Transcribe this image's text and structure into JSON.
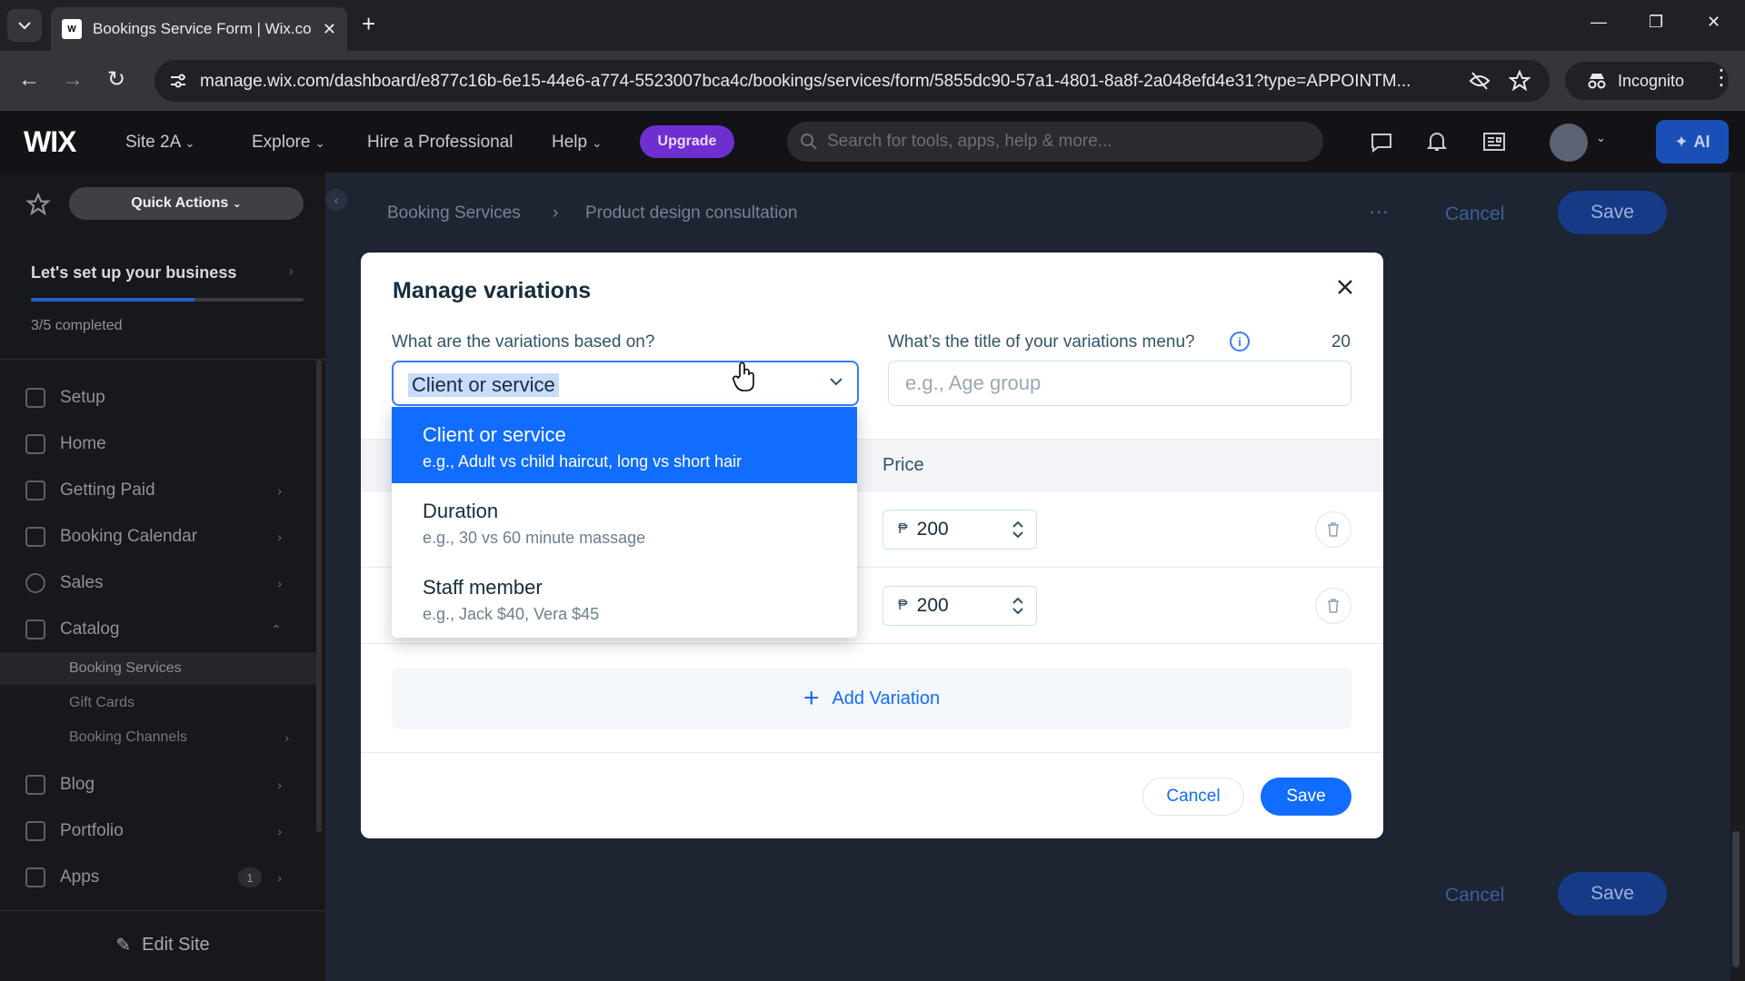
{
  "browser": {
    "tab_title": "Bookings Service Form | Wix.com",
    "url": "manage.wix.com/dashboard/e877c16b-6e15-44e6-a774-5523007bca4c/bookings/services/form/5855dc90-57a1-4801-8a8f-2a048efd4e31?type=APPOINTM...",
    "incognito_label": "Incognito"
  },
  "wix_bar": {
    "logo": "WIX",
    "site": "Site 2A",
    "explore": "Explore",
    "hire": "Hire a Professional",
    "help": "Help",
    "upgrade": "Upgrade",
    "search_placeholder": "Search for tools, apps, help & more...",
    "ai_label": "AI"
  },
  "sidebar": {
    "quick_actions": "Quick Actions",
    "setup_title": "Let's set up your business",
    "setup_progress": 0.6,
    "setup_sub": "3/5 completed",
    "items": [
      {
        "label": "Setup"
      },
      {
        "label": "Home"
      },
      {
        "label": "Getting Paid"
      },
      {
        "label": "Booking Calendar"
      },
      {
        "label": "Sales"
      },
      {
        "label": "Catalog"
      }
    ],
    "sub_items": [
      {
        "label": "Booking Services"
      },
      {
        "label": "Gift Cards"
      },
      {
        "label": "Booking Channels"
      }
    ],
    "items_bottom": [
      {
        "label": "Blog"
      },
      {
        "label": "Portfolio"
      },
      {
        "label": "Apps",
        "badge": "1"
      }
    ],
    "edit_site": "Edit Site"
  },
  "main": {
    "breadcrumb_root": "Booking Services",
    "breadcrumb_current": "Product design consultation",
    "cancel": "Cancel",
    "save": "Save"
  },
  "modal": {
    "title": "Manage variations",
    "based_on_label": "What are the variations based on?",
    "based_on_value": "Client or service",
    "menu_title_label": "What’s the title of your variations menu?",
    "menu_title_count": "20",
    "menu_title_placeholder": "e.g., Age group",
    "price_header": "Price",
    "rows": [
      {
        "currency": "₱",
        "price": "200"
      },
      {
        "currency": "₱",
        "price": "200"
      }
    ],
    "add_variation": "Add Variation",
    "cancel": "Cancel",
    "save": "Save"
  },
  "dropdown": {
    "options": [
      {
        "title": "Client or service",
        "desc": "e.g., Adult vs child haircut, long vs short hair",
        "selected": true
      },
      {
        "title": "Duration",
        "desc": "e.g., 30 vs 60 minute massage",
        "selected": false
      },
      {
        "title": "Staff member",
        "desc": "e.g., Jack $40, Vera $45",
        "selected": false
      }
    ]
  },
  "colors": {
    "accent": "#116dff",
    "upgrade": "#6f2fd0"
  }
}
